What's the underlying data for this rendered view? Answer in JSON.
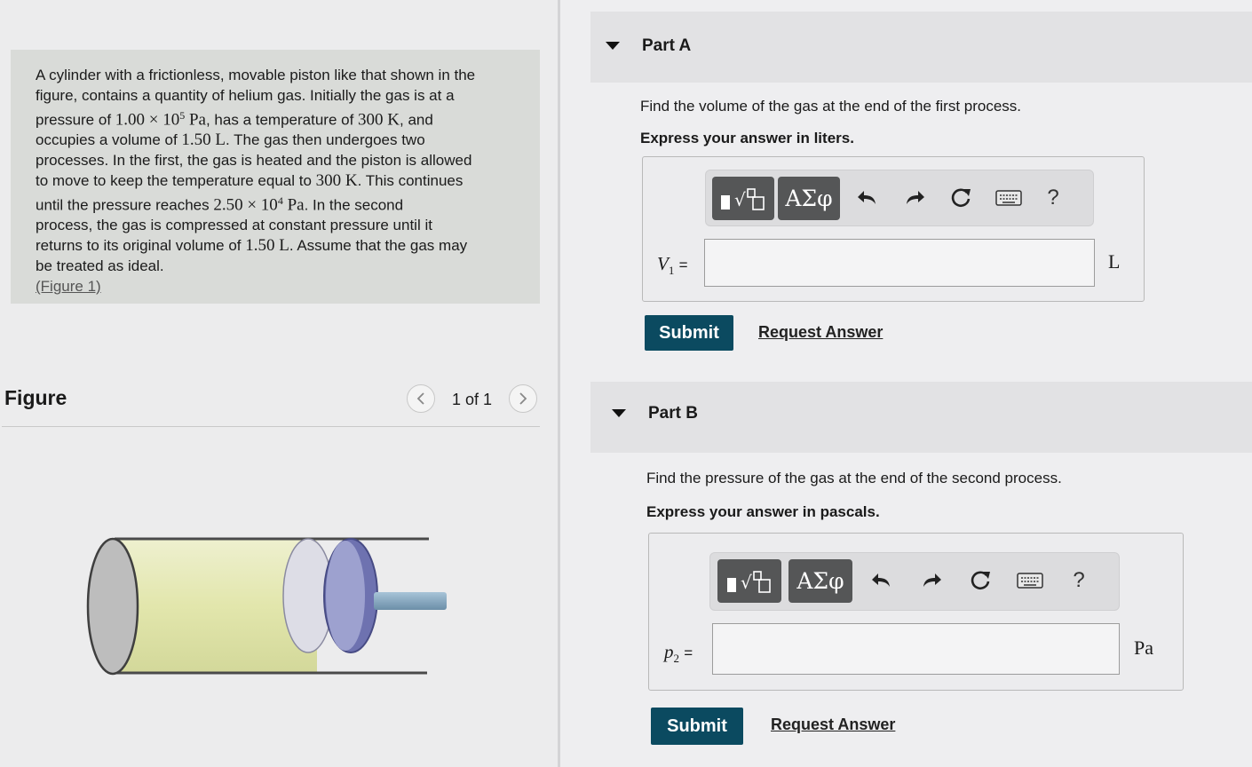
{
  "problem": {
    "line1": "A cylinder with a frictionless, movable piston like that shown in the",
    "line2": "figure, contains a quantity of helium gas. Initially the gas is at a",
    "line3_pre": "pressure of ",
    "p_initial": "1.00 × 10",
    "p_initial_exp": "5",
    "pa_unit": " Pa",
    "line3_mid": ", has a temperature of ",
    "temp": "300 K",
    "line3_post": ", and",
    "line4_pre": "occupies a volume of ",
    "volume": "1.50 L",
    "line4_post": ". The gas then undergoes two",
    "line5": "processes. In the first, the gas is heated and the piston is allowed",
    "line6_pre": "to move to keep the temperature equal to ",
    "temp2": "300 K",
    "line6_post": ". This continues",
    "line7_pre": "until the pressure reaches ",
    "p_reach": "2.50 × 10",
    "p_reach_exp": "4",
    "pa_unit2": " Pa",
    "line7_post": ". In the second",
    "line8": "process, the gas is compressed at constant pressure until it",
    "line9_pre": "returns to its original volume of ",
    "volume2": "1.50 L",
    "line9_post": ". Assume that the gas may",
    "line10": "be treated as ideal.",
    "figure_link": "(Figure 1)"
  },
  "figure": {
    "title": "Figure",
    "count": "1 of 1"
  },
  "parts": [
    {
      "label": "Part A",
      "question": "Find the volume of the gas at the end of the first process.",
      "instruction": "Express your answer in liters.",
      "variable": "V",
      "variable_sub": "1",
      "equals": "=",
      "unit": "L",
      "input_value": "",
      "greek_label": "ΑΣφ",
      "help_label": "?",
      "submit_label": "Submit",
      "request_label": "Request Answer"
    },
    {
      "label": "Part B",
      "question": "Find the pressure of the gas at the end of the second process.",
      "instruction": "Express your answer in pascals.",
      "variable": "p",
      "variable_sub": "2",
      "equals": "=",
      "unit": "Pa",
      "input_value": "",
      "greek_label": "ΑΣφ",
      "help_label": "?",
      "submit_label": "Submit",
      "request_label": "Request Answer"
    }
  ],
  "colors": {
    "submit": "#0b4a60",
    "toolbar_button": "#555657",
    "gas_fill": "#e4e8b4",
    "piston": "#6e72b0"
  }
}
